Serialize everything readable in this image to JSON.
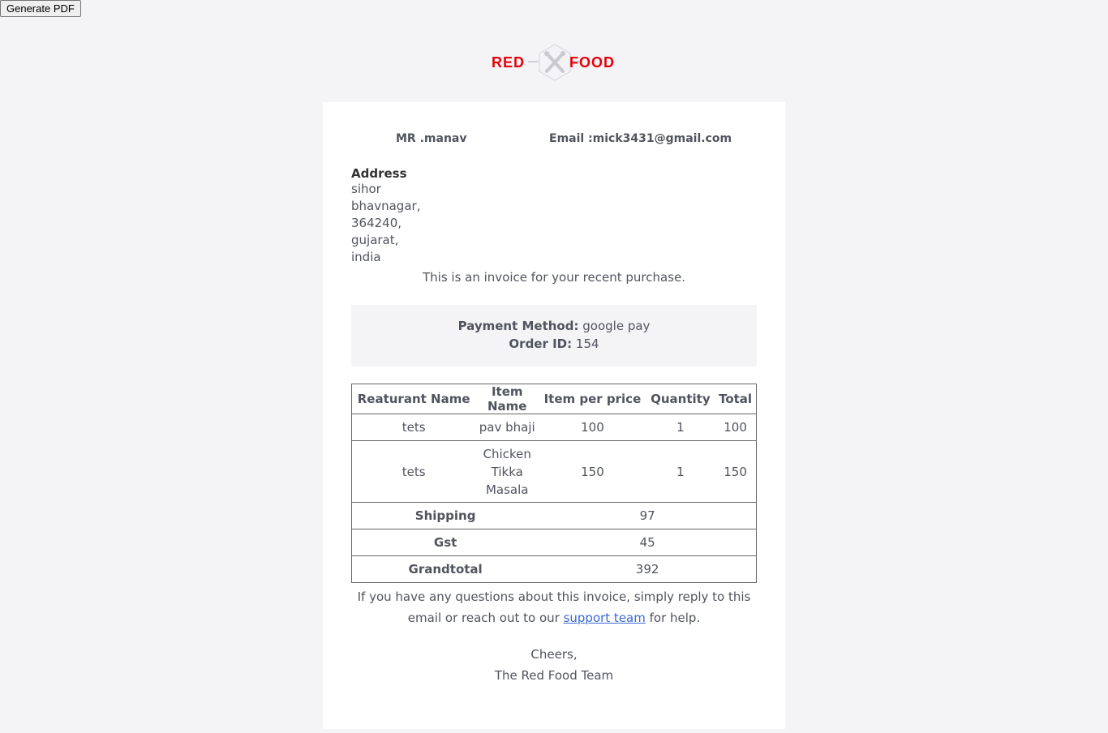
{
  "toolbar": {
    "generate_pdf_label": "Generate PDF"
  },
  "brand": {
    "left_word": "RED",
    "right_word": "FOOD",
    "accent_color": "#e8000b"
  },
  "customer": {
    "name": "MR .manav",
    "email": "Email :mick3431@gmail.com",
    "address_label": "Address",
    "address_lines": [
      "sihor",
      "bhavnagar,",
      "364240,",
      "gujarat,",
      "india"
    ]
  },
  "intro_text": "This is an invoice for your recent purchase.",
  "payment": {
    "method_label": "Payment Method:",
    "method_value": "google pay",
    "order_label": "Order ID:",
    "order_value": "154"
  },
  "table": {
    "headers": [
      "Reaturant Name",
      "Item Name",
      "Item per price",
      "Quantity",
      "Total"
    ],
    "rows": [
      [
        "tets",
        "pav bhaji",
        "100",
        "1",
        "100"
      ],
      [
        "tets",
        "Chicken Tikka Masala",
        "150",
        "1",
        "150"
      ]
    ],
    "summary": [
      {
        "label": "Shipping",
        "value": "97"
      },
      {
        "label": "Gst",
        "value": "45"
      },
      {
        "label": "Grandtotal",
        "value": "392"
      }
    ]
  },
  "help": {
    "before_link": "If you have any questions about this invoice, simply reply to this email or reach out to our",
    "link_text": "support team",
    "after_link": "for help."
  },
  "signoff": {
    "line1": "Cheers,",
    "line2": "The Red Food Team"
  }
}
